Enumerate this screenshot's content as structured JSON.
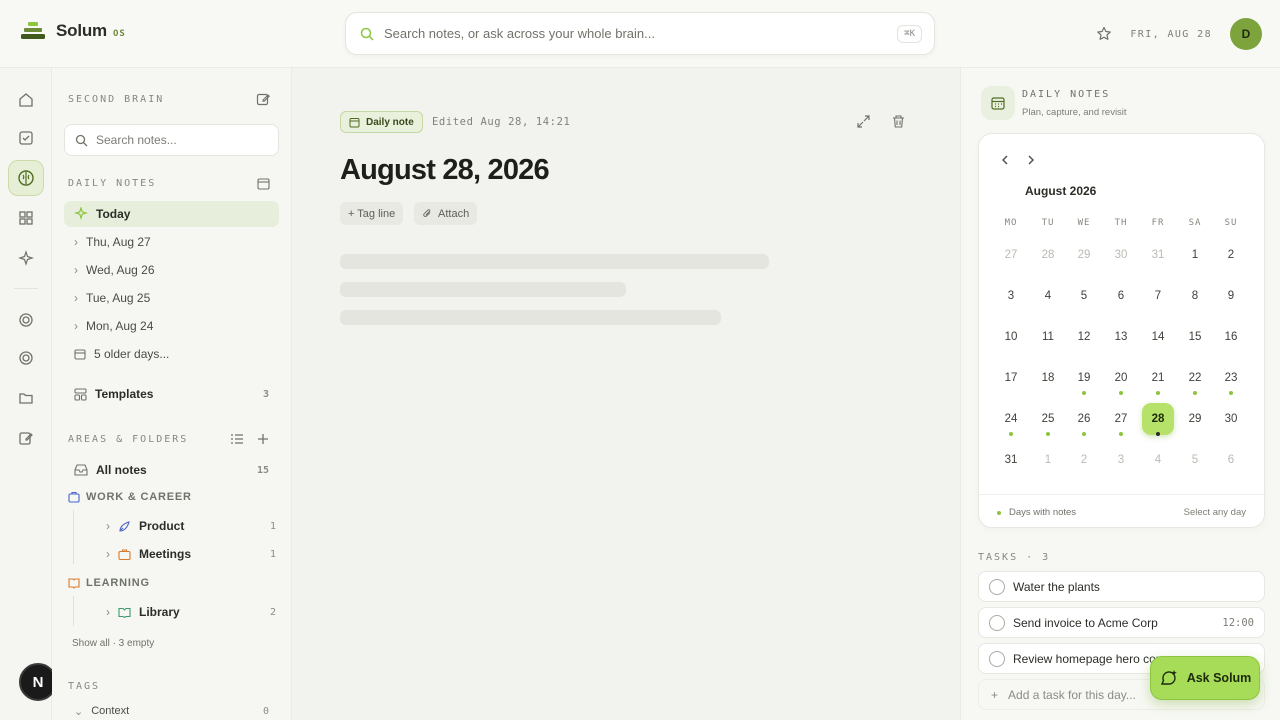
{
  "app": {
    "name": "Solum",
    "suffix": "OS"
  },
  "search": {
    "placeholder": "Search notes, or ask across your whole brain...",
    "shortcut": "⌘K"
  },
  "header": {
    "date": "FRI, AUG 28",
    "avatar_initial": "D"
  },
  "rail": {
    "icons": [
      "home-icon",
      "check-square-icon",
      "brain-icon",
      "grid-icon",
      "sparkle-icon",
      "target-icon",
      "target-icon",
      "folder-icon",
      "edit-icon"
    ],
    "badge": "N"
  },
  "sidebar": {
    "section_title": "SECOND BRAIN",
    "search_placeholder": "Search notes...",
    "daily_label": "DAILY NOTES",
    "today": "Today",
    "days": [
      "Thu, Aug 27",
      "Wed, Aug 26",
      "Tue, Aug 25",
      "Mon, Aug 24"
    ],
    "older": "5 older days...",
    "templates": {
      "label": "Templates",
      "count": "3"
    },
    "areas_label": "AREAS & FOLDERS",
    "all_notes": {
      "label": "All notes",
      "count": "15"
    },
    "work": {
      "label": "WORK & CAREER",
      "items": [
        {
          "label": "Product",
          "count": "1"
        },
        {
          "label": "Meetings",
          "count": "1"
        }
      ]
    },
    "learning": {
      "label": "LEARNING",
      "items": [
        {
          "label": "Library",
          "count": "2"
        }
      ]
    },
    "show_all": "Show all · 3 empty",
    "tags_label": "TAGS",
    "context": {
      "label": "Context",
      "count": "0"
    }
  },
  "main": {
    "badge": "Daily note",
    "edited": "Edited Aug 28, 14:21",
    "title": "August 28, 2026",
    "tag_chip": "+ Tag line",
    "attach_chip": "Attach"
  },
  "right": {
    "title": "DAILY NOTES",
    "subtitle": "Plan, capture, and revisit",
    "month": "August 2026",
    "dow": [
      "MO",
      "TU",
      "WE",
      "TH",
      "FR",
      "SA",
      "SU"
    ],
    "weeks": [
      [
        "27",
        "28",
        "29",
        "30",
        "31",
        "1",
        "2"
      ],
      [
        "3",
        "4",
        "5",
        "6",
        "7",
        "8",
        "9"
      ],
      [
        "10",
        "11",
        "12",
        "13",
        "14",
        "15",
        "16"
      ],
      [
        "17",
        "18",
        "19",
        "20",
        "21",
        "22",
        "23"
      ],
      [
        "24",
        "25",
        "26",
        "27",
        "28",
        "29",
        "30"
      ],
      [
        "31",
        "1",
        "2",
        "3",
        "4",
        "5",
        "6"
      ]
    ],
    "selected_day": "28",
    "legend": "Days with notes",
    "select_hint": "Select any day",
    "tasks_label": "TASKS · 3",
    "tasks": [
      {
        "label": "Water the plants",
        "time": ""
      },
      {
        "label": "Send invoice to Acme Corp",
        "time": "12:00"
      },
      {
        "label": "Review homepage hero cor",
        "time": ""
      }
    ],
    "add_task": "Add a task for this day..."
  },
  "ask_button": "Ask Solum",
  "colors": {
    "accent": "#a6dc58",
    "brand": "#6b8a3a",
    "dot": "#8cc63f"
  }
}
